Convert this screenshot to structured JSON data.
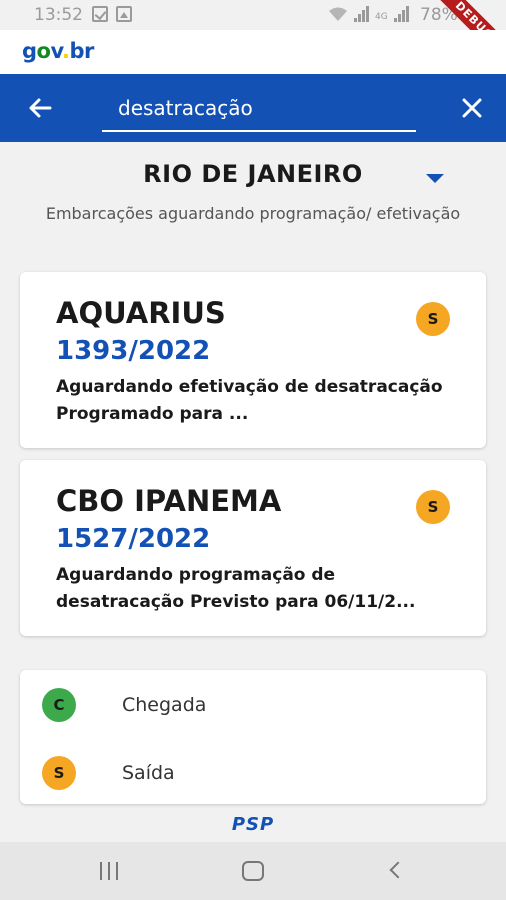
{
  "status_bar": {
    "time": "13:52",
    "battery": "78%",
    "network": "4G",
    "debug_banner": "DEBUG"
  },
  "brand": {
    "logo_parts": [
      "g",
      "o",
      "v",
      ".",
      "br"
    ],
    "colors": {
      "blue": "#1351b4",
      "green": "#168821",
      "yellow": "#ffcd07"
    }
  },
  "app_bar": {
    "search_value": "desatracação",
    "back_icon": "arrow-left-icon",
    "clear_icon": "close-icon",
    "color": "#1351b4"
  },
  "filter": {
    "state": "RIO DE JANEIRO",
    "subtitle": "Embarcações aguardando programação/ efetivação"
  },
  "vessels": [
    {
      "name": "AQUARIUS",
      "number": "1393/2022",
      "status": "Aguardando efetivação de desatracação Programado para ...",
      "badge": "S"
    },
    {
      "name": "CBO IPANEMA",
      "number": "1527/2022",
      "status": "Aguardando programação de desatracação Previsto para 06/11/2...",
      "badge": "S"
    }
  ],
  "legend": [
    {
      "badge": "C",
      "label": "Chegada",
      "color": "#3ca94a"
    },
    {
      "badge": "S",
      "label": "Saída",
      "color": "#f5a623"
    }
  ],
  "footer": {
    "logo_text": "PSP"
  }
}
